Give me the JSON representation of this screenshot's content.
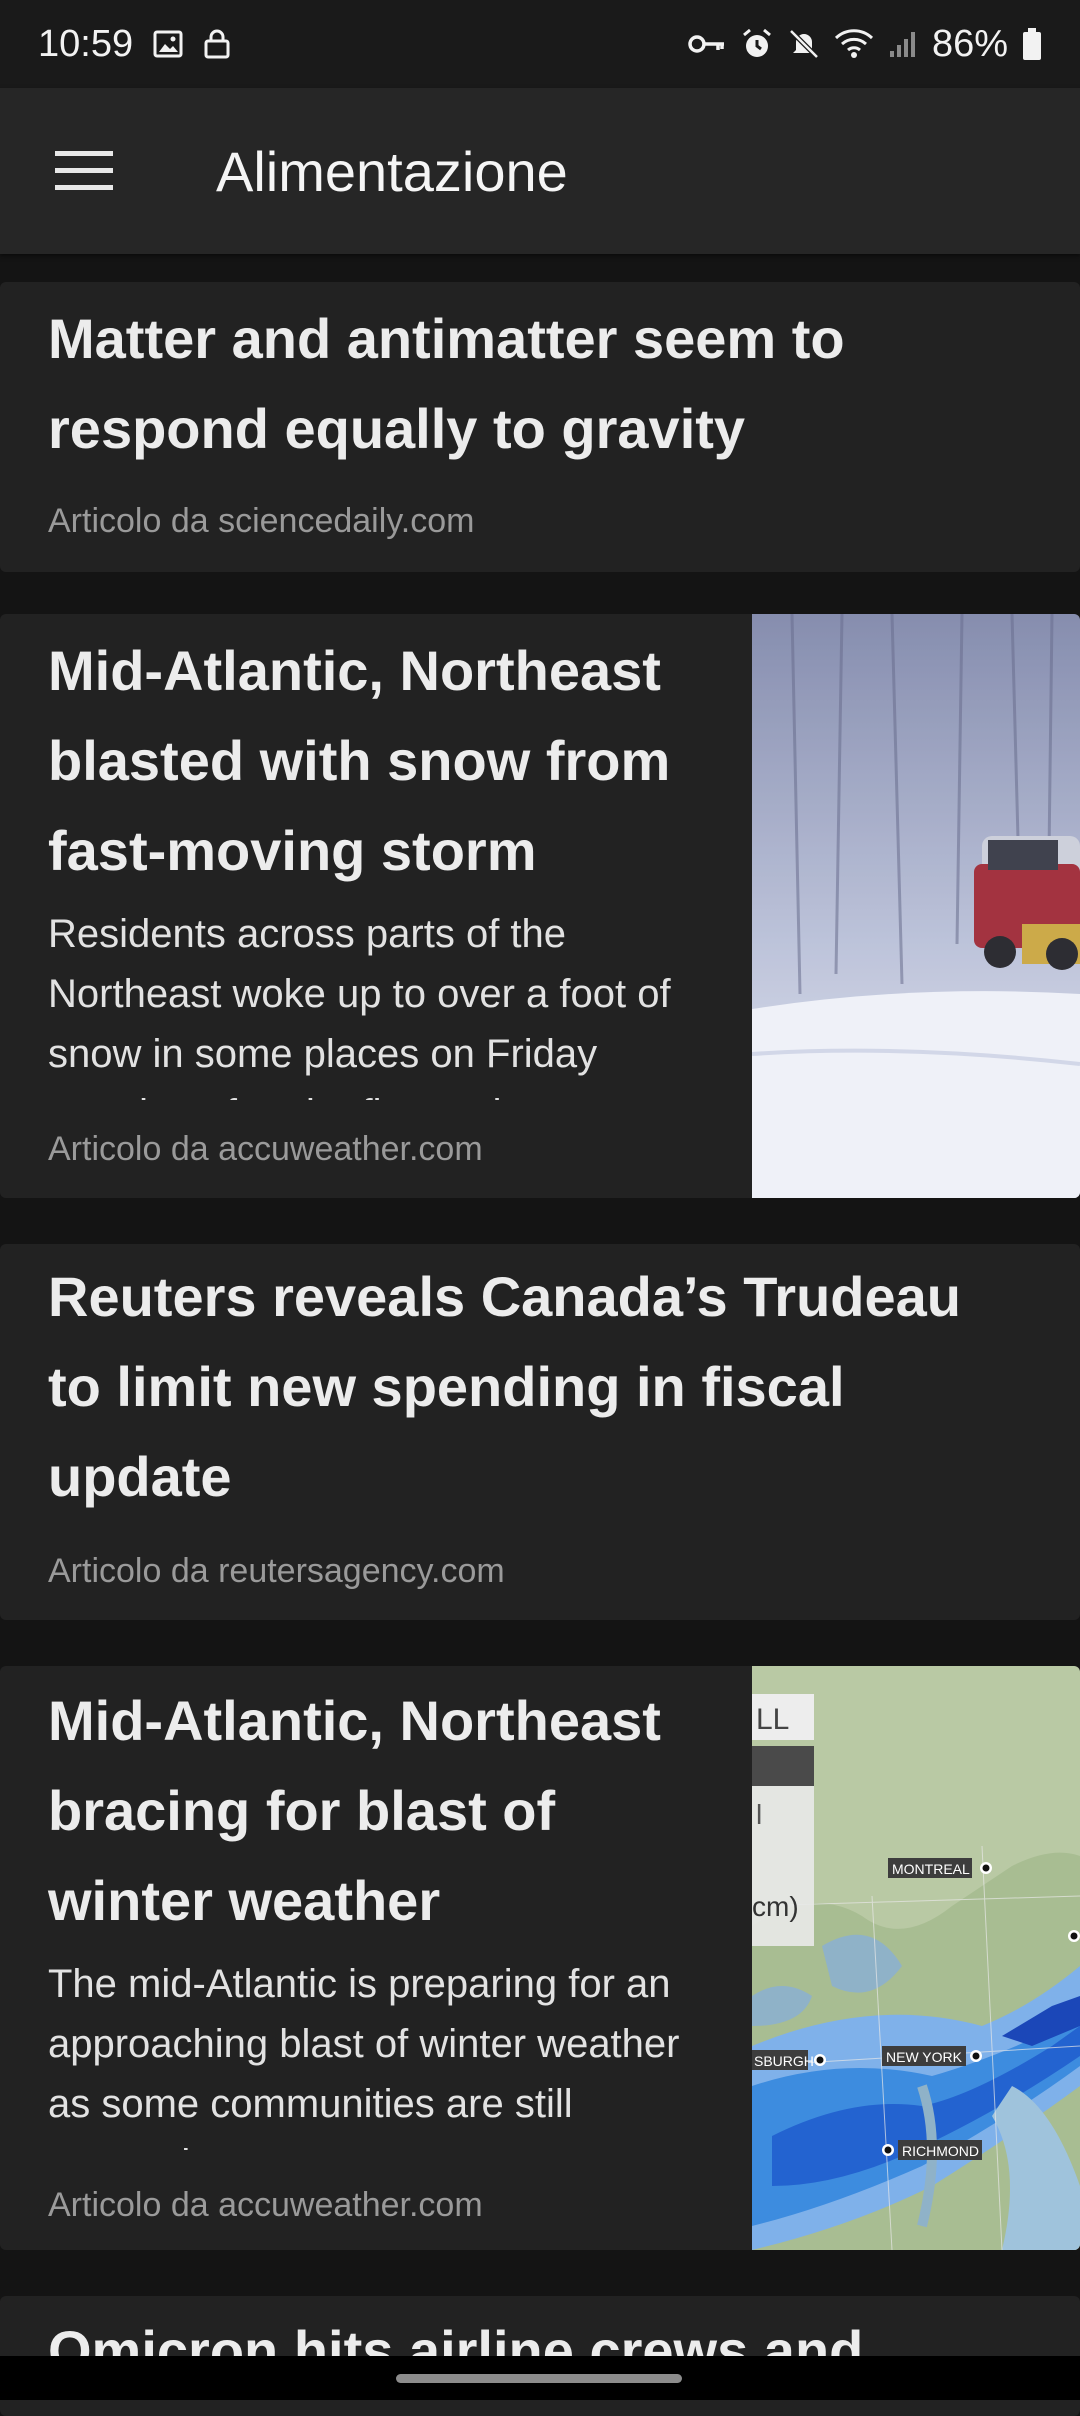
{
  "status_bar": {
    "time": "10:59",
    "battery": "86%",
    "left_icons": [
      "image-icon",
      "lock-icon"
    ],
    "right_icons": [
      "vpn-key-icon",
      "alarm-icon",
      "mute-icon",
      "wifi-icon",
      "signal-icon",
      "battery-icon"
    ]
  },
  "app_bar": {
    "menu_icon": "hamburger-menu-icon",
    "title": "Alimentazione"
  },
  "articles": [
    {
      "headline": "Matter and antimatter seem to respond equally to gravity",
      "source": "Articolo da sciencedaily.com"
    },
    {
      "headline": "Mid-Atlantic, Northeast blasted with snow from fast-moving storm",
      "snippet": "Residents across parts of the Northeast woke up to over a foot of snow in some places on Friday morning after the first major",
      "source": "Articolo da accuweather.com",
      "thumbnail": "snowy-road-truck-photo"
    },
    {
      "headline": "Reuters reveals Canada’s Trudeau to limit new spending in fiscal update",
      "source": "Articolo da reutersagency.com"
    },
    {
      "headline": "Mid-Atlantic, Northeast bracing for blast of winter weather",
      "snippet": "The mid-Atlantic is preparing for an approaching blast of winter weather as some communities are still recovering",
      "source": "Articolo da accuweather.com",
      "thumbnail": "snowfall-forecast-map",
      "map_labels": {
        "legend_top": "LL",
        "legend_mid": "l",
        "legend_unit": "cm)",
        "montreal": "MONTREAL",
        "pittsburgh": "SBURGH",
        "new_york": "NEW YORK",
        "richmond": "RICHMOND"
      }
    },
    {
      "headline": "Omicron hits airline crews and"
    }
  ]
}
